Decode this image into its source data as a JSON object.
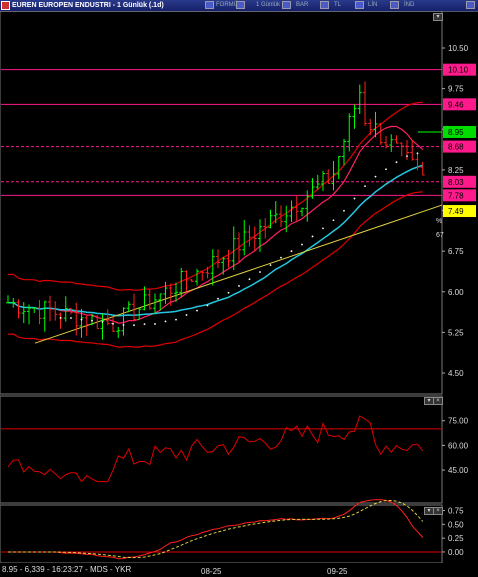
{
  "window": {
    "title": "EUREN EUROPEN ENDUSTRI - 1 Günlük (.1d)",
    "toolbar": [
      "FORMÜL",
      "1 Günlük",
      "BAR",
      "TL",
      "LİN",
      "İND"
    ]
  },
  "price_panel": {
    "axis_ticks": [
      "10.50",
      "9.75",
      "9.00",
      "8.25",
      "7.50",
      "6.75",
      "6.00",
      "5.25",
      "4.50"
    ],
    "last_price_label": "8.95",
    "levels": [
      {
        "label": "10.10",
        "value": 10.1,
        "color": "#ff1a8c",
        "style": "solid"
      },
      {
        "label": "9.46",
        "value": 9.46,
        "color": "#ff1a8c",
        "style": "solid"
      },
      {
        "label": "8.68",
        "value": 8.68,
        "color": "#ff1a8c",
        "style": "dashed"
      },
      {
        "label": "8.03",
        "value": 8.03,
        "color": "#ff1a8c",
        "style": "dashed"
      },
      {
        "label": "7.78",
        "value": 7.78,
        "color": "#ff1a8c",
        "style": "solid"
      },
      {
        "label": "7.49",
        "value": 7.49,
        "color": "#ffff00",
        "style": "none"
      }
    ],
    "side_marks": [
      "%",
      "67"
    ]
  },
  "rsi_panel": {
    "axis_ticks": [
      "75.00",
      "60.00",
      "45.00"
    ],
    "level": 70
  },
  "macd_panel": {
    "axis_ticks": [
      "0.75",
      "0.50",
      "0.25",
      "0.00"
    ]
  },
  "x_axis": {
    "date_labels": [
      "08-25",
      "09-25"
    ]
  },
  "status": {
    "text": "8.95 - 6,339 - 16:23:27 - MDS - YKR"
  },
  "colors": {
    "candle_up": "#00ff00",
    "candle_down": "#ff2020",
    "bollinger": "#e00000",
    "ma_fast": "#ff2060",
    "ma_slow": "#22c8e0",
    "trendline": "#e0d040",
    "sar": "#ffffff"
  }
}
